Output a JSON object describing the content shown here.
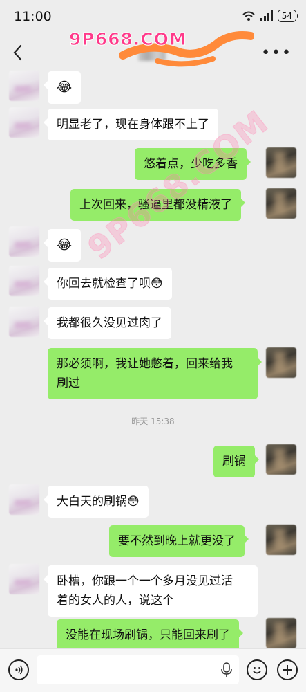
{
  "status": {
    "time": "11:00",
    "battery": "54"
  },
  "header": {
    "watermark": "9P668.COM",
    "diag_watermark": "9P668.COM"
  },
  "messages": [
    {
      "text": "😂"
    },
    {
      "text": "明显老了，现在身体跟不上了"
    },
    {
      "text": "悠着点，少吃多香"
    },
    {
      "text": "上次回来，骚逼里都没精液了"
    },
    {
      "text": "😂"
    },
    {
      "text": "你回去就检查了呗😳"
    },
    {
      "text": "我都很久没见过肉了"
    },
    {
      "line1": "那必须啊，我让她憋着，回来给我",
      "line2": "刷过"
    },
    {
      "text": "刷锅"
    },
    {
      "text": "大白天的刷锅😳"
    },
    {
      "text": "要不然到晚上就更没了"
    },
    {
      "line1": "卧槽，你跟一个一个多月没见过活",
      "line2": "着的女人的人，说这个"
    },
    {
      "text": "没能在现场刷锅，只能回来刷了"
    }
  ],
  "timestamp": "昨天 15:38",
  "icons": [
    "wifi-icon",
    "signal-icon",
    "back-icon",
    "more-icon",
    "voice-icon",
    "mic-icon",
    "emoji-icon",
    "plus-icon"
  ]
}
